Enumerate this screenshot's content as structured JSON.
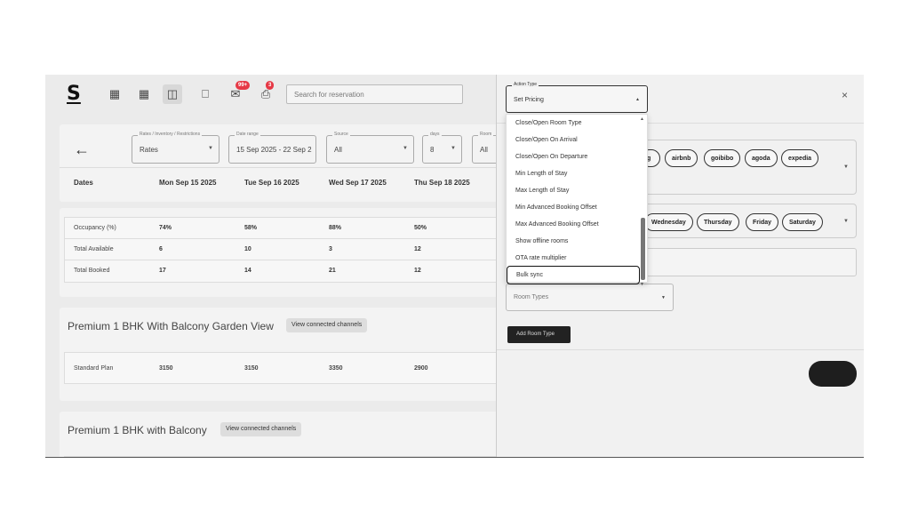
{
  "nav": {
    "logo": "S",
    "badges": {
      "messages": "99+",
      "reports": "3"
    },
    "search_placeholder": "Search for reservation"
  },
  "filters": {
    "rates": {
      "label": "Rates / Inventory / Restrictions",
      "value": "Rates"
    },
    "date_range": {
      "label": "Date range",
      "value": "15 Sep 2025 - 22 Sep 2"
    },
    "source": {
      "label": "Source",
      "value": "All"
    },
    "days": {
      "label": "days",
      "value": "8"
    },
    "room": {
      "label": "Room",
      "value": "All"
    }
  },
  "dates": {
    "label": "Dates",
    "columns": [
      "Mon Sep 15 2025",
      "Tue Sep 16 2025",
      "Wed Sep 17 2025",
      "Thu Sep 18 2025"
    ]
  },
  "stats": [
    {
      "label": "Occupancy (%)",
      "values": [
        "74%",
        "58%",
        "88%",
        "50%"
      ]
    },
    {
      "label": "Total Available",
      "values": [
        "6",
        "10",
        "3",
        "12"
      ]
    },
    {
      "label": "Total Booked",
      "values": [
        "17",
        "14",
        "21",
        "12"
      ]
    }
  ],
  "rooms": [
    {
      "title": "Premium 1 BHK With Balcony Garden View",
      "button": "View connected channels",
      "plan": "Standard Plan",
      "values": [
        "3150",
        "3150",
        "3350",
        "2900"
      ]
    },
    {
      "title": "Premium 1 BHK with Balcony",
      "button": "View connected channels"
    }
  ],
  "panel": {
    "action_type_label": "Action Type",
    "action_type_value": "Set Pricing",
    "close": "×",
    "dropdown_items": [
      "Close/Open Room Type",
      "Close/Open On Arrival",
      "Close/Open On Departure",
      "Min Length of Stay",
      "Max Length of Stay",
      "Min Advanced Booking Offset",
      "Max Advanced Booking Offset",
      "Show offline rooms",
      "OTA rate multiplier",
      "Bulk sync"
    ],
    "selected_item": "Bulk sync",
    "channels": [
      "g",
      "airbnb",
      "goibibo",
      "agoda",
      "expedia"
    ],
    "days": [
      "Wednesday",
      "Thursday",
      "Friday",
      "Saturday"
    ],
    "room_types_placeholder": "Room Types",
    "add_room_type": "Add Room Type"
  }
}
